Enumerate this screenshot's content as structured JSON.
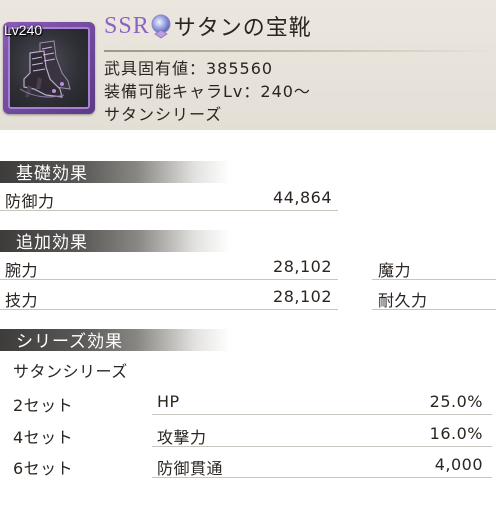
{
  "item": {
    "level": "Lv240",
    "rarity": "SSR",
    "name": "サタンの宝靴",
    "weapon_value": "武具固有値：385560",
    "equip_level": "装備可能キャラLv：240〜",
    "series": "サタンシリーズ",
    "icon": "boots-icon",
    "rarity_color": "#8c63c4",
    "frame_color": "#6d49a0"
  },
  "basic": {
    "title": "基礎効果",
    "rows": [
      {
        "label": "防御力",
        "value": "44,864"
      }
    ]
  },
  "additional": {
    "title": "追加効果",
    "rows": [
      {
        "label": "腕力",
        "value": "28,102",
        "label2": "魔力",
        "value2": ""
      },
      {
        "label": "技力",
        "value": "28,102",
        "label2": "耐久力",
        "value2": ""
      }
    ]
  },
  "series_effect": {
    "title": "シリーズ効果",
    "series_name": "サタンシリーズ",
    "rows": [
      {
        "set": "2セット",
        "stat": "HP",
        "value": "25.0%"
      },
      {
        "set": "4セット",
        "stat": "攻撃力",
        "value": "16.0%"
      },
      {
        "set": "6セット",
        "stat": "防御貫通",
        "value": "4,000"
      }
    ]
  }
}
